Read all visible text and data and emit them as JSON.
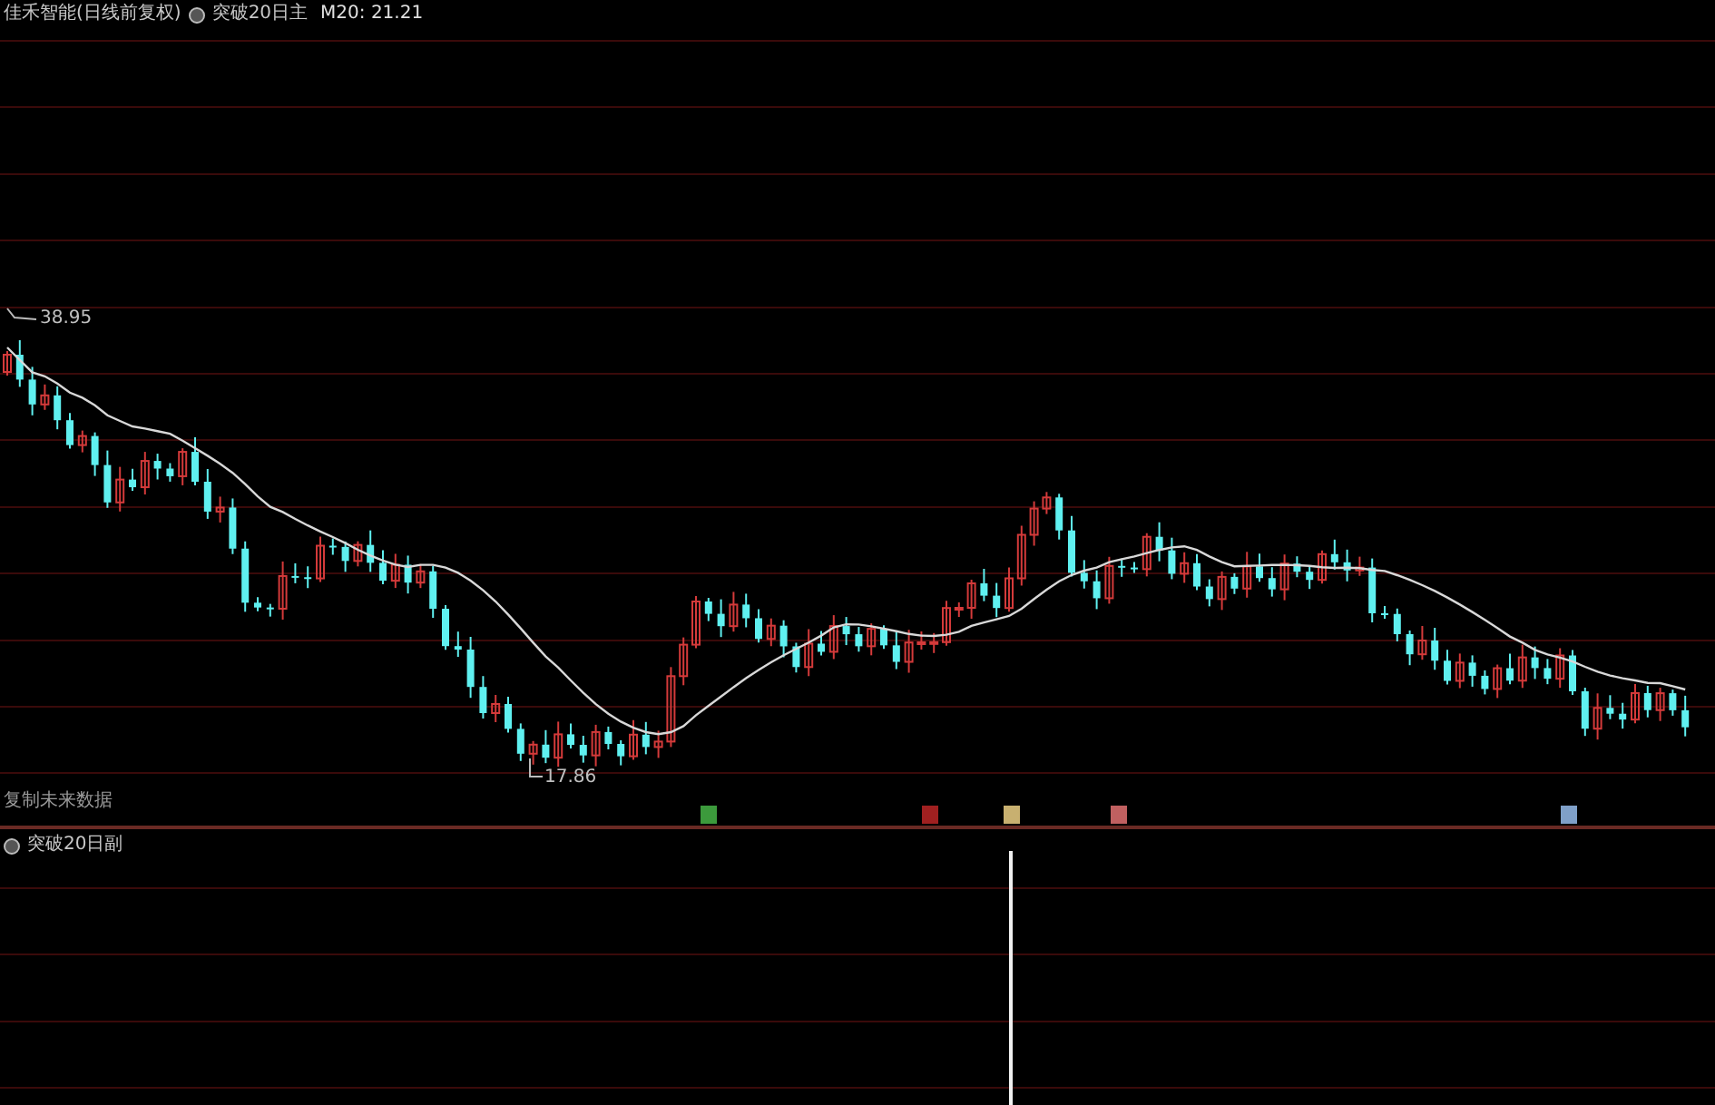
{
  "header": {
    "security": "佳禾智能(日线前复权)",
    "indicator": "突破20日主",
    "ma_reading": "M20: 21.21"
  },
  "price_labels": {
    "high": "38.95",
    "low": "17.86"
  },
  "note": "复制未来数据",
  "event_markers": [
    {
      "color": "#3c9a3c"
    },
    {
      "color": "#a02020"
    },
    {
      "color": "#c8b070"
    },
    {
      "color": "#c06060"
    },
    {
      "color": "#7fa0c8"
    }
  ],
  "sub_panel": {
    "indicator": "突破20日副"
  }
}
